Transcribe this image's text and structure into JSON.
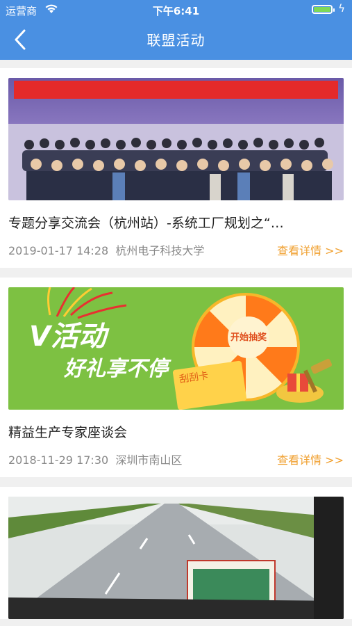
{
  "status_bar": {
    "carrier": "运营商",
    "time": "下午6:41",
    "battery_level": 1.0
  },
  "nav": {
    "title": "联盟活动",
    "back_icon": "chevron-left-icon"
  },
  "colors": {
    "nav_bg": "#4a90e2",
    "detail_link": "#f0a030",
    "promo_green": "#7dc142"
  },
  "activities": [
    {
      "title": "专题分享交流会（杭州站）-系统工厂规划之“…",
      "datetime": "2019-01-17 14:28",
      "location": "杭州电子科技大学",
      "detail_label": "查看详情 >>",
      "image": "conference-group-photo"
    },
    {
      "title": "精益生产专家座谈会",
      "datetime": "2018-11-29 17:30",
      "location": "深圳市南山区",
      "detail_label": "查看详情 >>",
      "image": "promo-banner",
      "image_text": {
        "line1": "V活动",
        "line2": "好礼享不停",
        "wheel_center": "开始抽奖",
        "card": "刮刮卡"
      }
    },
    {
      "image": "road-photo"
    }
  ]
}
